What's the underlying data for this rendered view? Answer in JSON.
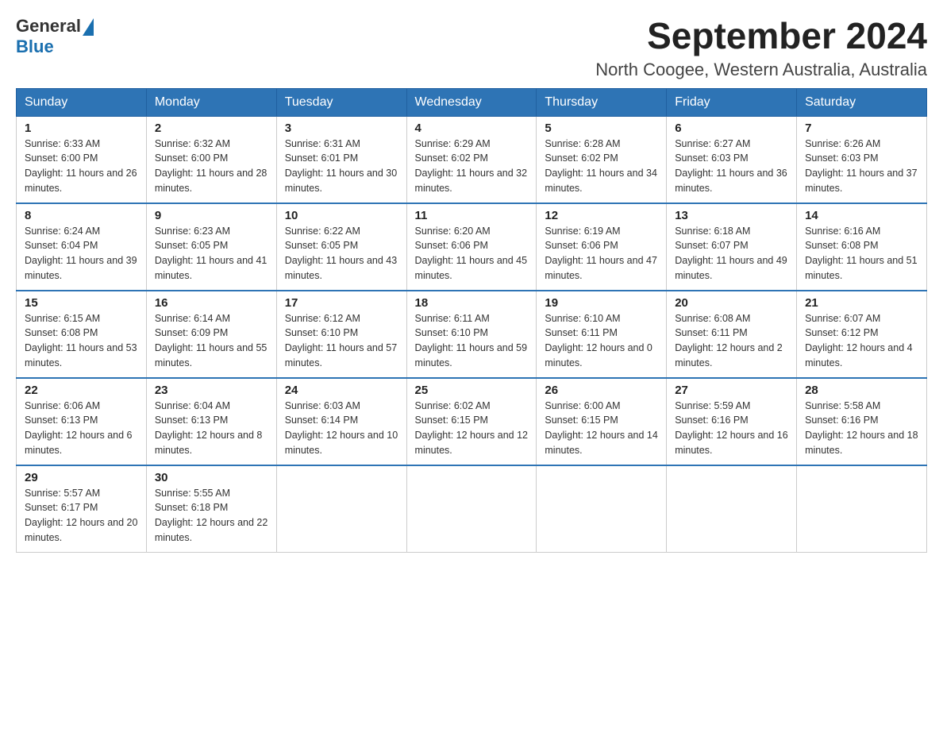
{
  "header": {
    "logo_general": "General",
    "logo_blue": "Blue",
    "month_title": "September 2024",
    "location": "North Coogee, Western Australia, Australia"
  },
  "days_of_week": [
    "Sunday",
    "Monday",
    "Tuesday",
    "Wednesday",
    "Thursday",
    "Friday",
    "Saturday"
  ],
  "weeks": [
    [
      {
        "day": "1",
        "sunrise": "6:33 AM",
        "sunset": "6:00 PM",
        "daylight": "11 hours and 26 minutes."
      },
      {
        "day": "2",
        "sunrise": "6:32 AM",
        "sunset": "6:00 PM",
        "daylight": "11 hours and 28 minutes."
      },
      {
        "day": "3",
        "sunrise": "6:31 AM",
        "sunset": "6:01 PM",
        "daylight": "11 hours and 30 minutes."
      },
      {
        "day": "4",
        "sunrise": "6:29 AM",
        "sunset": "6:02 PM",
        "daylight": "11 hours and 32 minutes."
      },
      {
        "day": "5",
        "sunrise": "6:28 AM",
        "sunset": "6:02 PM",
        "daylight": "11 hours and 34 minutes."
      },
      {
        "day": "6",
        "sunrise": "6:27 AM",
        "sunset": "6:03 PM",
        "daylight": "11 hours and 36 minutes."
      },
      {
        "day": "7",
        "sunrise": "6:26 AM",
        "sunset": "6:03 PM",
        "daylight": "11 hours and 37 minutes."
      }
    ],
    [
      {
        "day": "8",
        "sunrise": "6:24 AM",
        "sunset": "6:04 PM",
        "daylight": "11 hours and 39 minutes."
      },
      {
        "day": "9",
        "sunrise": "6:23 AM",
        "sunset": "6:05 PM",
        "daylight": "11 hours and 41 minutes."
      },
      {
        "day": "10",
        "sunrise": "6:22 AM",
        "sunset": "6:05 PM",
        "daylight": "11 hours and 43 minutes."
      },
      {
        "day": "11",
        "sunrise": "6:20 AM",
        "sunset": "6:06 PM",
        "daylight": "11 hours and 45 minutes."
      },
      {
        "day": "12",
        "sunrise": "6:19 AM",
        "sunset": "6:06 PM",
        "daylight": "11 hours and 47 minutes."
      },
      {
        "day": "13",
        "sunrise": "6:18 AM",
        "sunset": "6:07 PM",
        "daylight": "11 hours and 49 minutes."
      },
      {
        "day": "14",
        "sunrise": "6:16 AM",
        "sunset": "6:08 PM",
        "daylight": "11 hours and 51 minutes."
      }
    ],
    [
      {
        "day": "15",
        "sunrise": "6:15 AM",
        "sunset": "6:08 PM",
        "daylight": "11 hours and 53 minutes."
      },
      {
        "day": "16",
        "sunrise": "6:14 AM",
        "sunset": "6:09 PM",
        "daylight": "11 hours and 55 minutes."
      },
      {
        "day": "17",
        "sunrise": "6:12 AM",
        "sunset": "6:10 PM",
        "daylight": "11 hours and 57 minutes."
      },
      {
        "day": "18",
        "sunrise": "6:11 AM",
        "sunset": "6:10 PM",
        "daylight": "11 hours and 59 minutes."
      },
      {
        "day": "19",
        "sunrise": "6:10 AM",
        "sunset": "6:11 PM",
        "daylight": "12 hours and 0 minutes."
      },
      {
        "day": "20",
        "sunrise": "6:08 AM",
        "sunset": "6:11 PM",
        "daylight": "12 hours and 2 minutes."
      },
      {
        "day": "21",
        "sunrise": "6:07 AM",
        "sunset": "6:12 PM",
        "daylight": "12 hours and 4 minutes."
      }
    ],
    [
      {
        "day": "22",
        "sunrise": "6:06 AM",
        "sunset": "6:13 PM",
        "daylight": "12 hours and 6 minutes."
      },
      {
        "day": "23",
        "sunrise": "6:04 AM",
        "sunset": "6:13 PM",
        "daylight": "12 hours and 8 minutes."
      },
      {
        "day": "24",
        "sunrise": "6:03 AM",
        "sunset": "6:14 PM",
        "daylight": "12 hours and 10 minutes."
      },
      {
        "day": "25",
        "sunrise": "6:02 AM",
        "sunset": "6:15 PM",
        "daylight": "12 hours and 12 minutes."
      },
      {
        "day": "26",
        "sunrise": "6:00 AM",
        "sunset": "6:15 PM",
        "daylight": "12 hours and 14 minutes."
      },
      {
        "day": "27",
        "sunrise": "5:59 AM",
        "sunset": "6:16 PM",
        "daylight": "12 hours and 16 minutes."
      },
      {
        "day": "28",
        "sunrise": "5:58 AM",
        "sunset": "6:16 PM",
        "daylight": "12 hours and 18 minutes."
      }
    ],
    [
      {
        "day": "29",
        "sunrise": "5:57 AM",
        "sunset": "6:17 PM",
        "daylight": "12 hours and 20 minutes."
      },
      {
        "day": "30",
        "sunrise": "5:55 AM",
        "sunset": "6:18 PM",
        "daylight": "12 hours and 22 minutes."
      },
      null,
      null,
      null,
      null,
      null
    ]
  ]
}
